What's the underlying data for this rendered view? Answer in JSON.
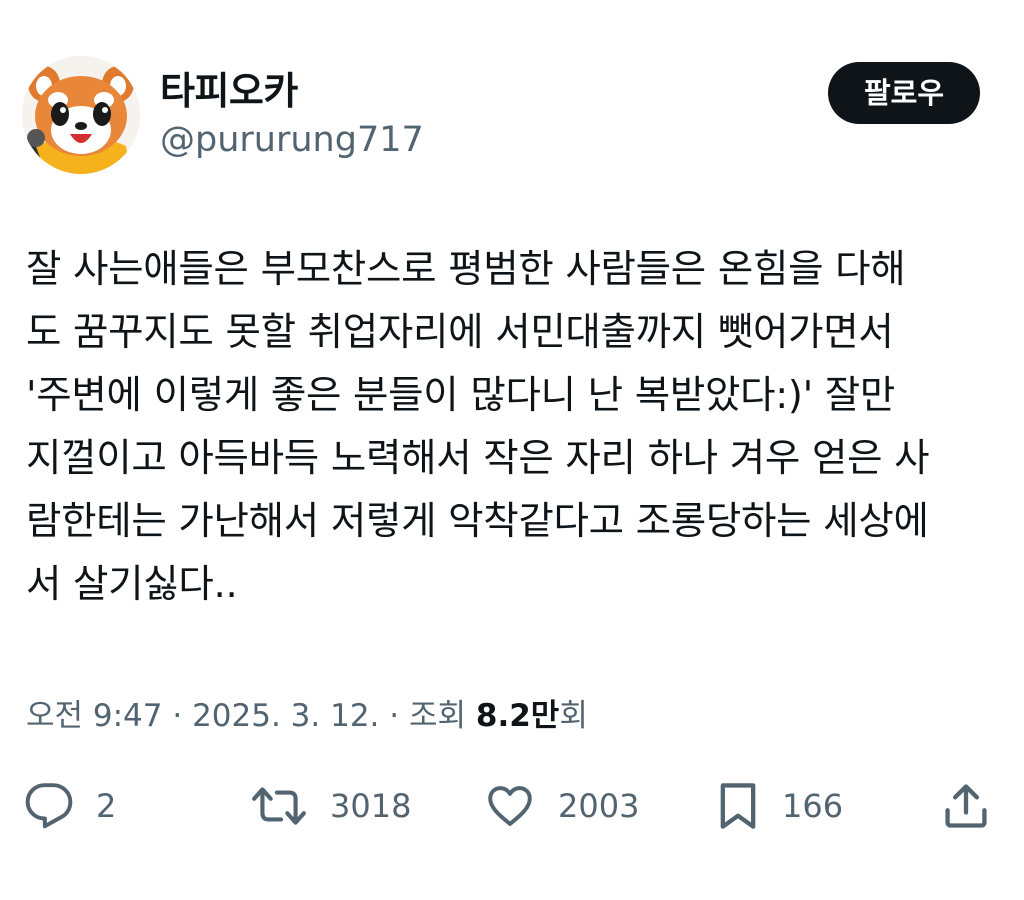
{
  "author": {
    "display_name": "타피오카",
    "handle": "@pururung717"
  },
  "follow_button": {
    "label": "팔로우"
  },
  "tweet": {
    "lines": [
      "잘 사는애들은 부모찬스로 평범한 사람들은 온힘을 다해",
      "도 꿈꾸지도 못할 취업자리에 서민대출까지 뺏어가면서",
      "'주변에 이렇게 좋은 분들이 많다니 난 복받았다:)' 잘만",
      "지껄이고 아득바득 노력해서 작은 자리 하나 겨우 얻은 사",
      "람한테는 가난해서 저렇게 악착같다고 조롱당하는 세상에",
      "서 살기싫다.."
    ]
  },
  "meta": {
    "time": "오전 9:47",
    "separator": " · ",
    "date": "2025. 3. 12.",
    "views_label": "조회 ",
    "views_count": "8.2만",
    "views_suffix": "회"
  },
  "actions": {
    "reply": {
      "icon": "reply-bubble-icon",
      "count": "2"
    },
    "retweet": {
      "icon": "retweet-icon",
      "count": "3018"
    },
    "like": {
      "icon": "heart-icon",
      "count": "2003"
    },
    "bookmark": {
      "icon": "bookmark-icon",
      "count": "166"
    },
    "share": {
      "icon": "share-icon"
    }
  },
  "colors": {
    "text_primary": "#0f1419",
    "text_secondary": "#536471",
    "follow_bg": "#0f1419",
    "avatar_accent": "#f5b21c"
  }
}
